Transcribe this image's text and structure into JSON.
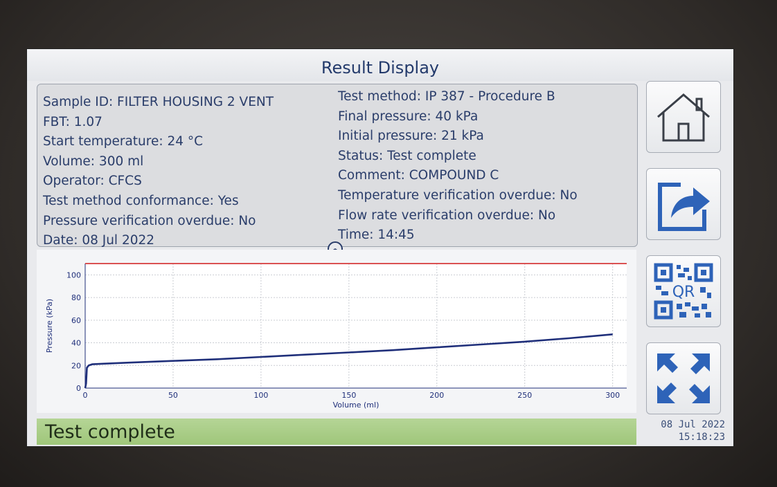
{
  "window": {
    "title": "Result Display"
  },
  "info": {
    "left": [
      "Sample ID: FILTER HOUSING 2 VENT",
      "FBT: 1.07",
      "Start temperature: 24 °C",
      "Volume: 300 ml",
      "Operator: CFCS",
      "Test method conformance: Yes",
      "Pressure verification overdue: No",
      "Date: 08 Jul 2022"
    ],
    "right": [
      "Test method: IP 387 - Procedure B",
      "Final pressure: 40 kPa",
      "Initial pressure: 21 kPa",
      "Status: Test complete",
      "Comment: COMPOUND C",
      "Temperature verification overdue: No",
      "Flow rate verification overdue: No",
      "Time: 14:45"
    ]
  },
  "buttons": {
    "home": "home-icon",
    "export": "export-icon",
    "qr": "qr-code-icon",
    "qr_label": "QR",
    "fullscreen": "expand-icon"
  },
  "status": {
    "text": "Test complete"
  },
  "clock": {
    "date": "08 Jul 2022",
    "time": "15:18:23"
  },
  "colors": {
    "series": "#1f2f7a",
    "limit": "#d63a3a",
    "accent": "#2e63b8",
    "status_bg": "#a9cd85"
  },
  "chart_data": {
    "type": "line",
    "xlabel": "Volume (ml)",
    "ylabel": "Pressure (kPa)",
    "xlim": [
      0,
      308
    ],
    "ylim": [
      0,
      110
    ],
    "xticks": [
      0,
      50,
      100,
      150,
      200,
      250,
      300
    ],
    "yticks": [
      0,
      20,
      40,
      60,
      80,
      100
    ],
    "grid": true,
    "series": [
      {
        "role": "pressure",
        "x": [
          0,
          0.5,
          1,
          2,
          4,
          10,
          25,
          50,
          75,
          100,
          125,
          150,
          175,
          200,
          225,
          250,
          275,
          300
        ],
        "y": [
          0,
          4,
          18,
          20,
          21,
          21.5,
          22.5,
          24,
          25.5,
          27.5,
          29.5,
          31.5,
          33.5,
          36,
          38.5,
          41,
          44,
          47.5
        ]
      },
      {
        "role": "limit",
        "x": [
          0,
          308
        ],
        "y": [
          110,
          110
        ]
      }
    ]
  }
}
